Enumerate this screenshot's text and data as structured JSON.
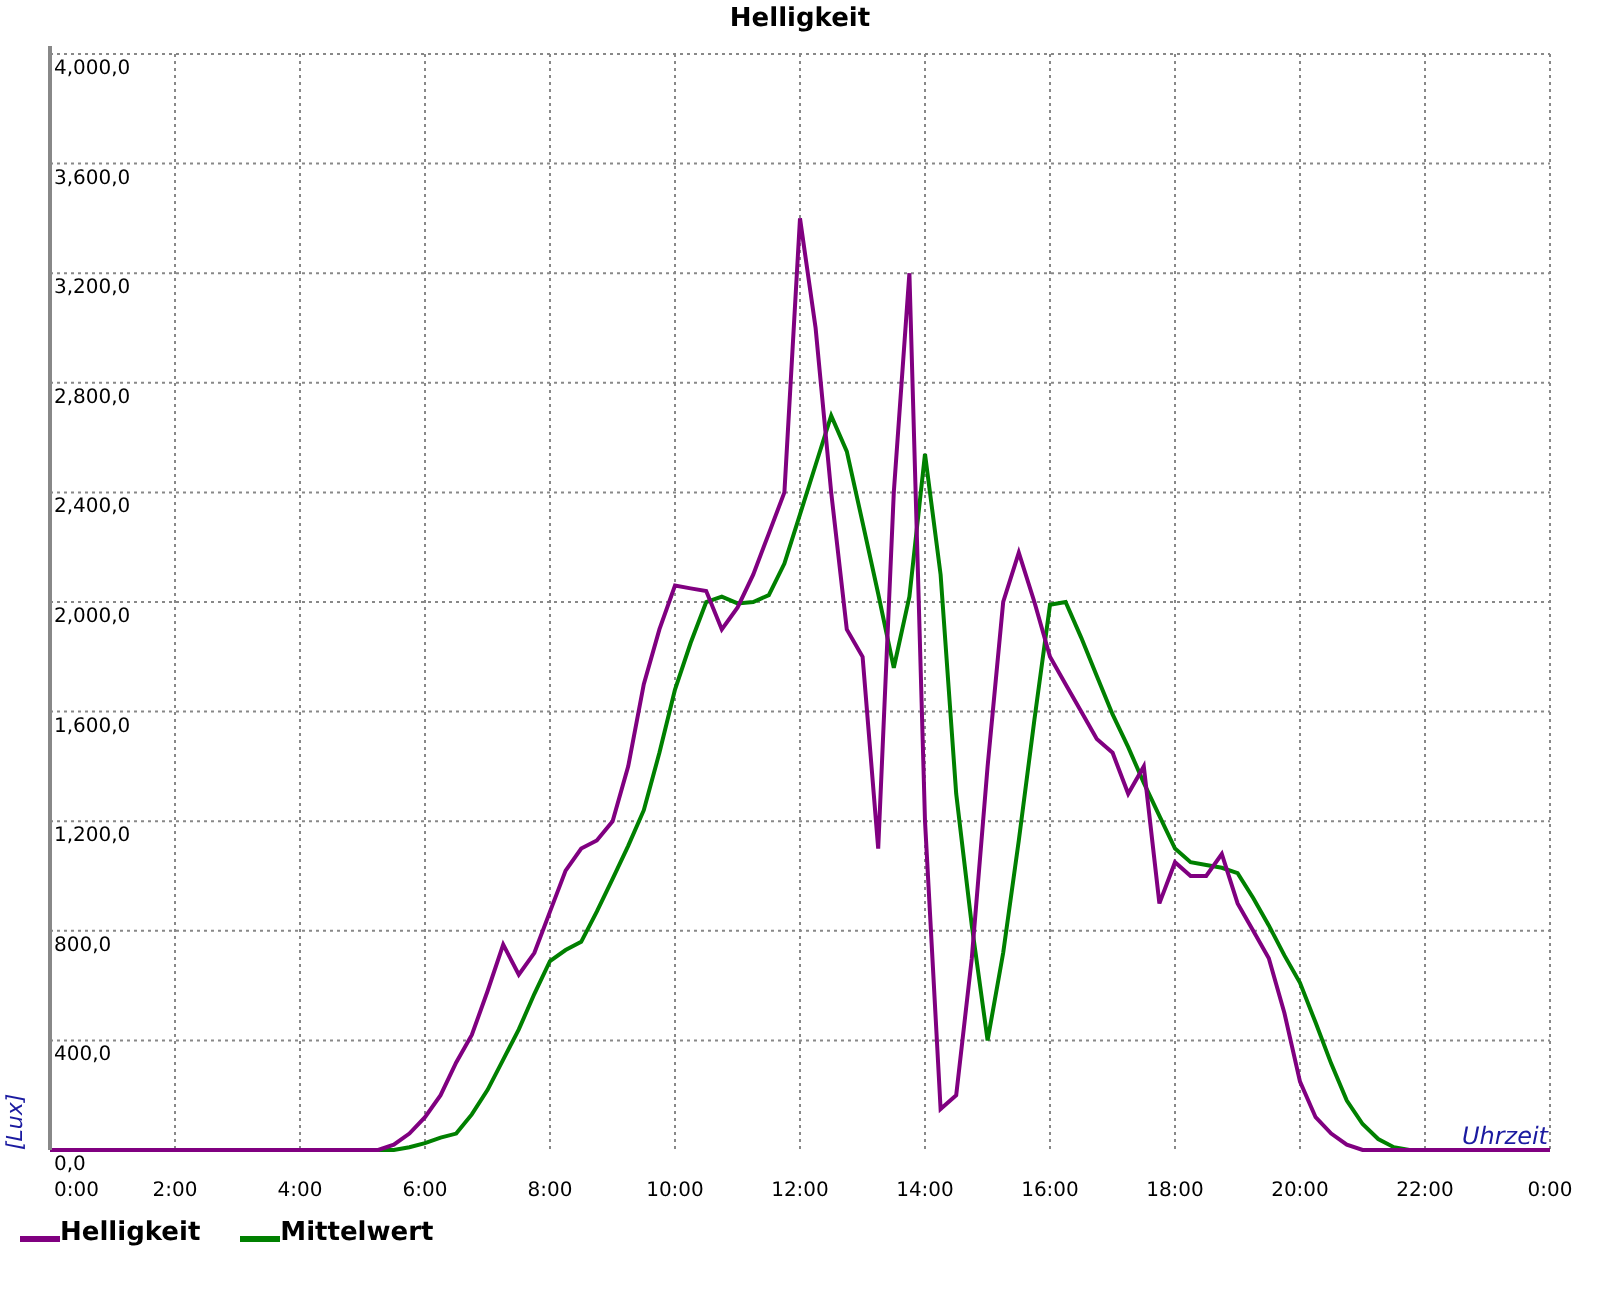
{
  "chart_data": {
    "type": "line",
    "title": "Helligkeit",
    "xlabel": "Uhrzeit",
    "ylabel": "[Lux]",
    "x": [
      0,
      5,
      5.25,
      5.5,
      5.75,
      6,
      6.25,
      6.5,
      6.75,
      7,
      7.25,
      7.5,
      7.75,
      8,
      8.25,
      8.5,
      8.75,
      9,
      9.25,
      9.5,
      9.75,
      10,
      10.25,
      10.5,
      10.75,
      11,
      11.25,
      11.5,
      11.75,
      12,
      12.25,
      12.5,
      12.75,
      13,
      13.25,
      13.5,
      13.75,
      14,
      14.25,
      14.5,
      14.75,
      15,
      15.25,
      15.5,
      15.75,
      16,
      16.25,
      16.5,
      16.75,
      17,
      17.25,
      17.5,
      17.75,
      18,
      18.25,
      18.5,
      18.75,
      19,
      19.25,
      19.5,
      19.75,
      20,
      20.25,
      20.5,
      20.75,
      21,
      21.25,
      21.5,
      21.75,
      24
    ],
    "series": [
      {
        "name": "Helligkeit",
        "color": "#800080",
        "values": [
          0,
          0,
          0,
          20,
          60,
          120,
          200,
          320,
          420,
          580,
          750,
          640,
          720,
          870,
          1020,
          1100,
          1130,
          1200,
          1400,
          1700,
          1900,
          2060,
          2050,
          2040,
          1900,
          1980,
          2100,
          2250,
          2400,
          3400,
          3000,
          2400,
          1900,
          1800,
          1100,
          2400,
          3200,
          1200,
          150,
          200,
          700,
          1400,
          2000,
          2180,
          2000,
          1800,
          1700,
          1600,
          1500,
          1450,
          1300,
          1400,
          900,
          1050,
          1000,
          1000,
          1080,
          900,
          800,
          700,
          500,
          250,
          120,
          60,
          20,
          0,
          0,
          0,
          0,
          0
        ]
      },
      {
        "name": "Mittelwert",
        "color": "#008000",
        "values": [
          0,
          0,
          0,
          0,
          10,
          25,
          45,
          60,
          130,
          220,
          330,
          440,
          570,
          690,
          730,
          760,
          870,
          990,
          1110,
          1240,
          1450,
          1680,
          1850,
          2000,
          2020,
          1995,
          2000,
          2025,
          2140,
          2320,
          2500,
          2680,
          2550,
          2290,
          2030,
          1760,
          2020,
          2540,
          2100,
          1300,
          820,
          400,
          720,
          1130,
          1570,
          1990,
          2000,
          1870,
          1730,
          1590,
          1470,
          1340,
          1220,
          1100,
          1050,
          1040,
          1030,
          1010,
          920,
          820,
          710,
          610,
          465,
          315,
          180,
          95,
          40,
          10,
          0,
          0
        ]
      }
    ],
    "grid": true,
    "legend": "bottom",
    "xlim": [
      0,
      24
    ],
    "ylim": [
      0,
      4000
    ],
    "xticks": [
      {
        "value": 0,
        "label": "0:00"
      },
      {
        "value": 2,
        "label": "2:00"
      },
      {
        "value": 4,
        "label": "4:00"
      },
      {
        "value": 6,
        "label": "6:00"
      },
      {
        "value": 8,
        "label": "8:00"
      },
      {
        "value": 10,
        "label": "10:00"
      },
      {
        "value": 12,
        "label": "12:00"
      },
      {
        "value": 14,
        "label": "14:00"
      },
      {
        "value": 16,
        "label": "16:00"
      },
      {
        "value": 18,
        "label": "18:00"
      },
      {
        "value": 20,
        "label": "20:00"
      },
      {
        "value": 22,
        "label": "22:00"
      },
      {
        "value": 24,
        "label": "0:00"
      }
    ],
    "yticks": [
      {
        "value": 0,
        "label": "0,0"
      },
      {
        "value": 400,
        "label": "400,0"
      },
      {
        "value": 800,
        "label": "800,0"
      },
      {
        "value": 1200,
        "label": "1,200,0"
      },
      {
        "value": 1600,
        "label": "1,600,0"
      },
      {
        "value": 2000,
        "label": "2,000,0"
      },
      {
        "value": 2400,
        "label": "2,400,0"
      },
      {
        "value": 2800,
        "label": "2,800,0"
      },
      {
        "value": 3200,
        "label": "3,200,0"
      },
      {
        "value": 3600,
        "label": "3,600,0"
      },
      {
        "value": 4000,
        "label": "4,000,0"
      }
    ]
  }
}
